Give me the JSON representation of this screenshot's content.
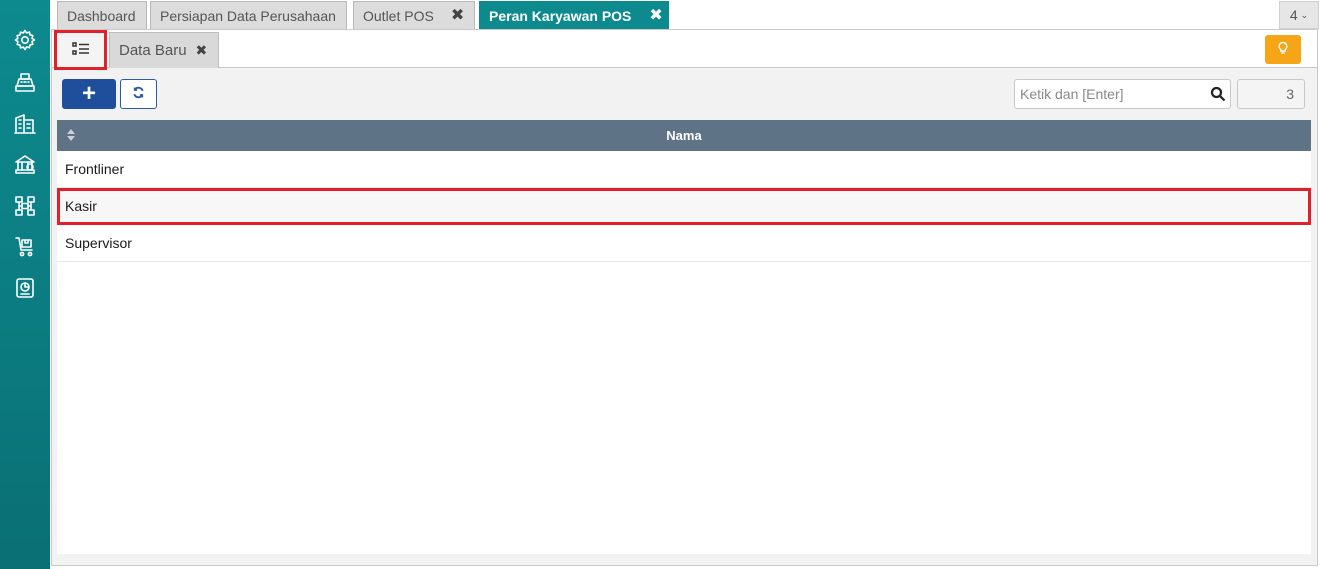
{
  "sidebar": {
    "icons": [
      "settings-icon",
      "register-icon",
      "building-icon",
      "bank-icon",
      "network-icon",
      "cart-icon",
      "report-icon"
    ]
  },
  "tabs": [
    {
      "label": "Dashboard",
      "closable": false,
      "active": false
    },
    {
      "label": "Persiapan Data Perusahaan",
      "closable": false,
      "active": false
    },
    {
      "label": "Outlet POS",
      "closable": true,
      "active": false
    },
    {
      "label": "Peran Karyawan POS",
      "closable": true,
      "active": true
    }
  ],
  "tab_count": {
    "value": "4"
  },
  "subtabs": {
    "list_view_icon": "list-icon",
    "data_baru": "Data Baru",
    "close_glyph": "✖",
    "hint_icon": "lightbulb-icon"
  },
  "toolbar": {
    "add_label": "+",
    "refresh_icon": "refresh-icon",
    "search_placeholder": "Ketik dan [Enter]",
    "search_value": "",
    "count": "3"
  },
  "grid": {
    "column": "Nama",
    "rows": [
      "Frontliner",
      "Kasir",
      "Supervisor"
    ],
    "selected_index": 1
  },
  "colors": {
    "accent": "#0d8a8e",
    "primary_button": "#1e4e9c",
    "header": "#5f7386",
    "hint": "#f5a516",
    "highlight": "#e0202a"
  }
}
